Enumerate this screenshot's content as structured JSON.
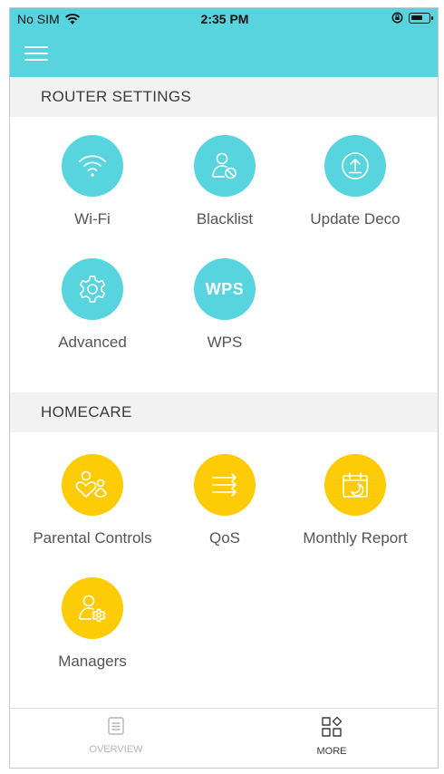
{
  "status_bar": {
    "carrier": "No SIM",
    "time": "2:35 PM"
  },
  "router_settings": {
    "title": "ROUTER SETTINGS",
    "items": [
      {
        "label": "Wi-Fi",
        "icon": "wifi-icon"
      },
      {
        "label": "Blacklist",
        "icon": "blacklist-icon"
      },
      {
        "label": "Update Deco",
        "icon": "update-icon"
      },
      {
        "label": "Advanced",
        "icon": "gear-icon"
      },
      {
        "label": "WPS",
        "icon": "wps-icon",
        "icon_text": "WPS"
      }
    ]
  },
  "homecare": {
    "title": "HOMECARE",
    "items": [
      {
        "label": "Parental Controls",
        "icon": "parental-controls-icon"
      },
      {
        "label": "QoS",
        "icon": "qos-icon"
      },
      {
        "label": "Monthly Report",
        "icon": "calendar-icon"
      },
      {
        "label": "Managers",
        "icon": "managers-icon"
      }
    ]
  },
  "tabbar": {
    "tabs": [
      {
        "label": "OVERVIEW",
        "icon": "overview-icon"
      },
      {
        "label": "MORE",
        "icon": "more-grid-icon",
        "active": true
      }
    ]
  },
  "colors": {
    "teal": "#57d4de",
    "yellow": "#fdcc06",
    "inactive": "#b5b5b5",
    "active": "#3a3a3a"
  }
}
